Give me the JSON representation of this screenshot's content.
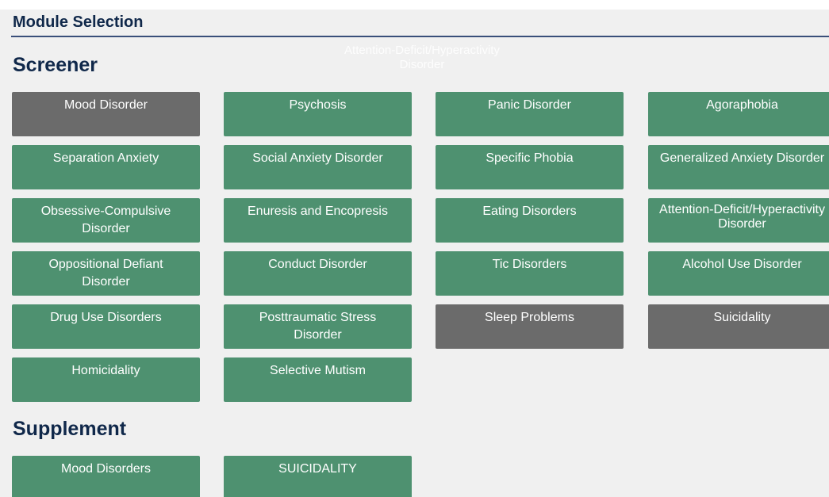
{
  "header": {
    "title": "Module Selection"
  },
  "tooltip": {
    "text": "Attention-Deficit/Hyperactivity Disorder"
  },
  "screener": {
    "heading": "Screener",
    "modules": [
      "Mood Disorder",
      "Psychosis",
      "Panic Disorder",
      "Agoraphobia",
      "Separation Anxiety",
      "Social Anxiety Disorder",
      "Specific Phobia",
      "Generalized Anxiety Disorder",
      "Obsessive-Compulsive Disorder",
      "Enuresis and Encopresis",
      "Eating Disorders",
      "Attention-Deficit/Hyperactivity Disorder",
      "Oppositional Defiant Disorder",
      "Conduct Disorder",
      "Tic Disorders",
      "Alcohol Use Disorder",
      "Drug Use Disorders",
      "Posttraumatic Stress Disorder",
      "Sleep Problems",
      "Suicidality",
      "Homicidality",
      "Selective Mutism"
    ]
  },
  "supplement": {
    "heading": "Supplement",
    "modules": [
      "Mood Disorders",
      "SUICIDALITY"
    ]
  },
  "colors": {
    "tile_enabled": "#4e9170",
    "tile_disabled": "#6b6b6b",
    "heading": "#10284a"
  }
}
